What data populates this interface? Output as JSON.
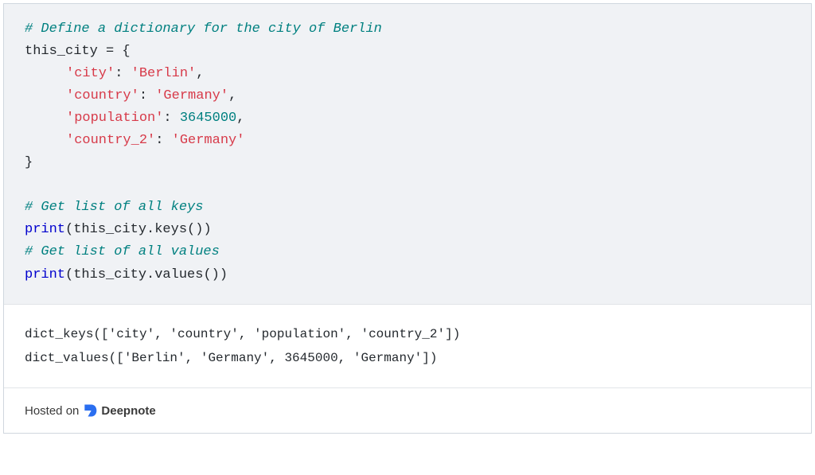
{
  "code": {
    "comment1": "# Define a dictionary for the city of Berlin",
    "line2_var": "this_city = {",
    "kv1_key": "'city'",
    "kv1_sep": ": ",
    "kv1_val": "'Berlin'",
    "kv2_key": "'country'",
    "kv2_sep": ": ",
    "kv2_val": "'Germany'",
    "kv3_key": "'population'",
    "kv3_sep": ": ",
    "kv3_val": "3645000",
    "kv4_key": "'country_2'",
    "kv4_sep": ": ",
    "kv4_val": "'Germany'",
    "close_brace": "}",
    "comment2": "# Get list of all keys",
    "print1_kw": "print",
    "print1_rest": "(this_city.keys())",
    "comment3": "# Get list of all values",
    "print2_kw": "print",
    "print2_rest": "(this_city.values())",
    "comma": ","
  },
  "output": {
    "line1": "dict_keys(['city', 'country', 'population', 'country_2'])",
    "line2": "dict_values(['Berlin', 'Germany', 3645000, 'Germany'])"
  },
  "footer": {
    "hosted_on": "Hosted on ",
    "brand": "Deepnote"
  }
}
